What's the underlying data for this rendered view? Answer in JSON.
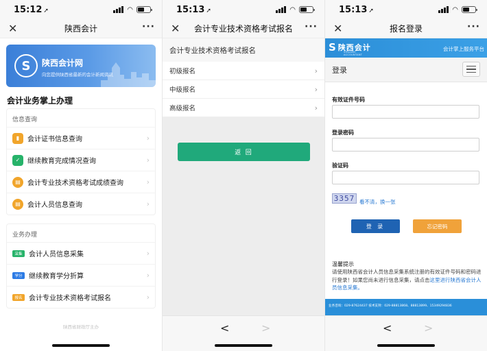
{
  "phones": [
    {
      "time": "15:12",
      "nav_title": "陕西会计",
      "banner": {
        "title": "陕西会计网",
        "subtitle": "向您提供陕西省最新的会计新闻资讯"
      },
      "section_title": "会计业务掌上办理",
      "group1": {
        "label": "信息查询",
        "items": [
          {
            "label": "会计证书信息查询",
            "icon": "certificate-icon"
          },
          {
            "label": "继续教育完成情况查询",
            "icon": "calendar-check-icon"
          },
          {
            "label": "会计专业技术资格考试成绩查询",
            "icon": "document-icon"
          },
          {
            "label": "会计人员信息查询",
            "icon": "document-icon"
          }
        ]
      },
      "group2": {
        "label": "业务办理",
        "items": [
          {
            "label": "会计人员信息采集",
            "badge": "采集"
          },
          {
            "label": "继续教育学分折算",
            "badge": "学分"
          },
          {
            "label": "会计专业技术资格考试报名",
            "badge": "报名"
          }
        ]
      },
      "footer": "陕西省财政厅主办"
    },
    {
      "time": "15:13",
      "nav_title": "会计专业技术资格考试报名",
      "header": "会计专业技术资格考试报名",
      "items": [
        "初级报名",
        "中级报名",
        "高级报名"
      ],
      "return_label": "返 回"
    },
    {
      "time": "15:13",
      "nav_title": "报名登录",
      "header_logo_cn": "陕西会计",
      "header_logo_en": "SHAANXI ACCOUNTANT",
      "header_right": "会计掌上服务平台",
      "login_title": "登录",
      "fields": {
        "id_label": "有效证件号码",
        "password_label": "登录密码",
        "captcha_label": "验证码"
      },
      "captcha_text": "3357",
      "captcha_refresh": "看不清，换一张",
      "login_button": "登 录",
      "forgot_button": "忘记密码",
      "tip_title": "温馨提示",
      "tip_text": "请使用陕西省会计人员信息采集系统注册的有效证件号码和密码进行登录！如果您尚未进行信息采集，请点击",
      "tip_link": "这里进行陕西省会计人员信息采集。",
      "footer": "业务咨询：029-87624437 技术支持：029-88813868、88813899、15349294836"
    }
  ],
  "colors": {
    "brand_blue": "#2b8ed8",
    "green": "#20a97b",
    "login_blue": "#1f63b3",
    "orange": "#f0a23a"
  }
}
